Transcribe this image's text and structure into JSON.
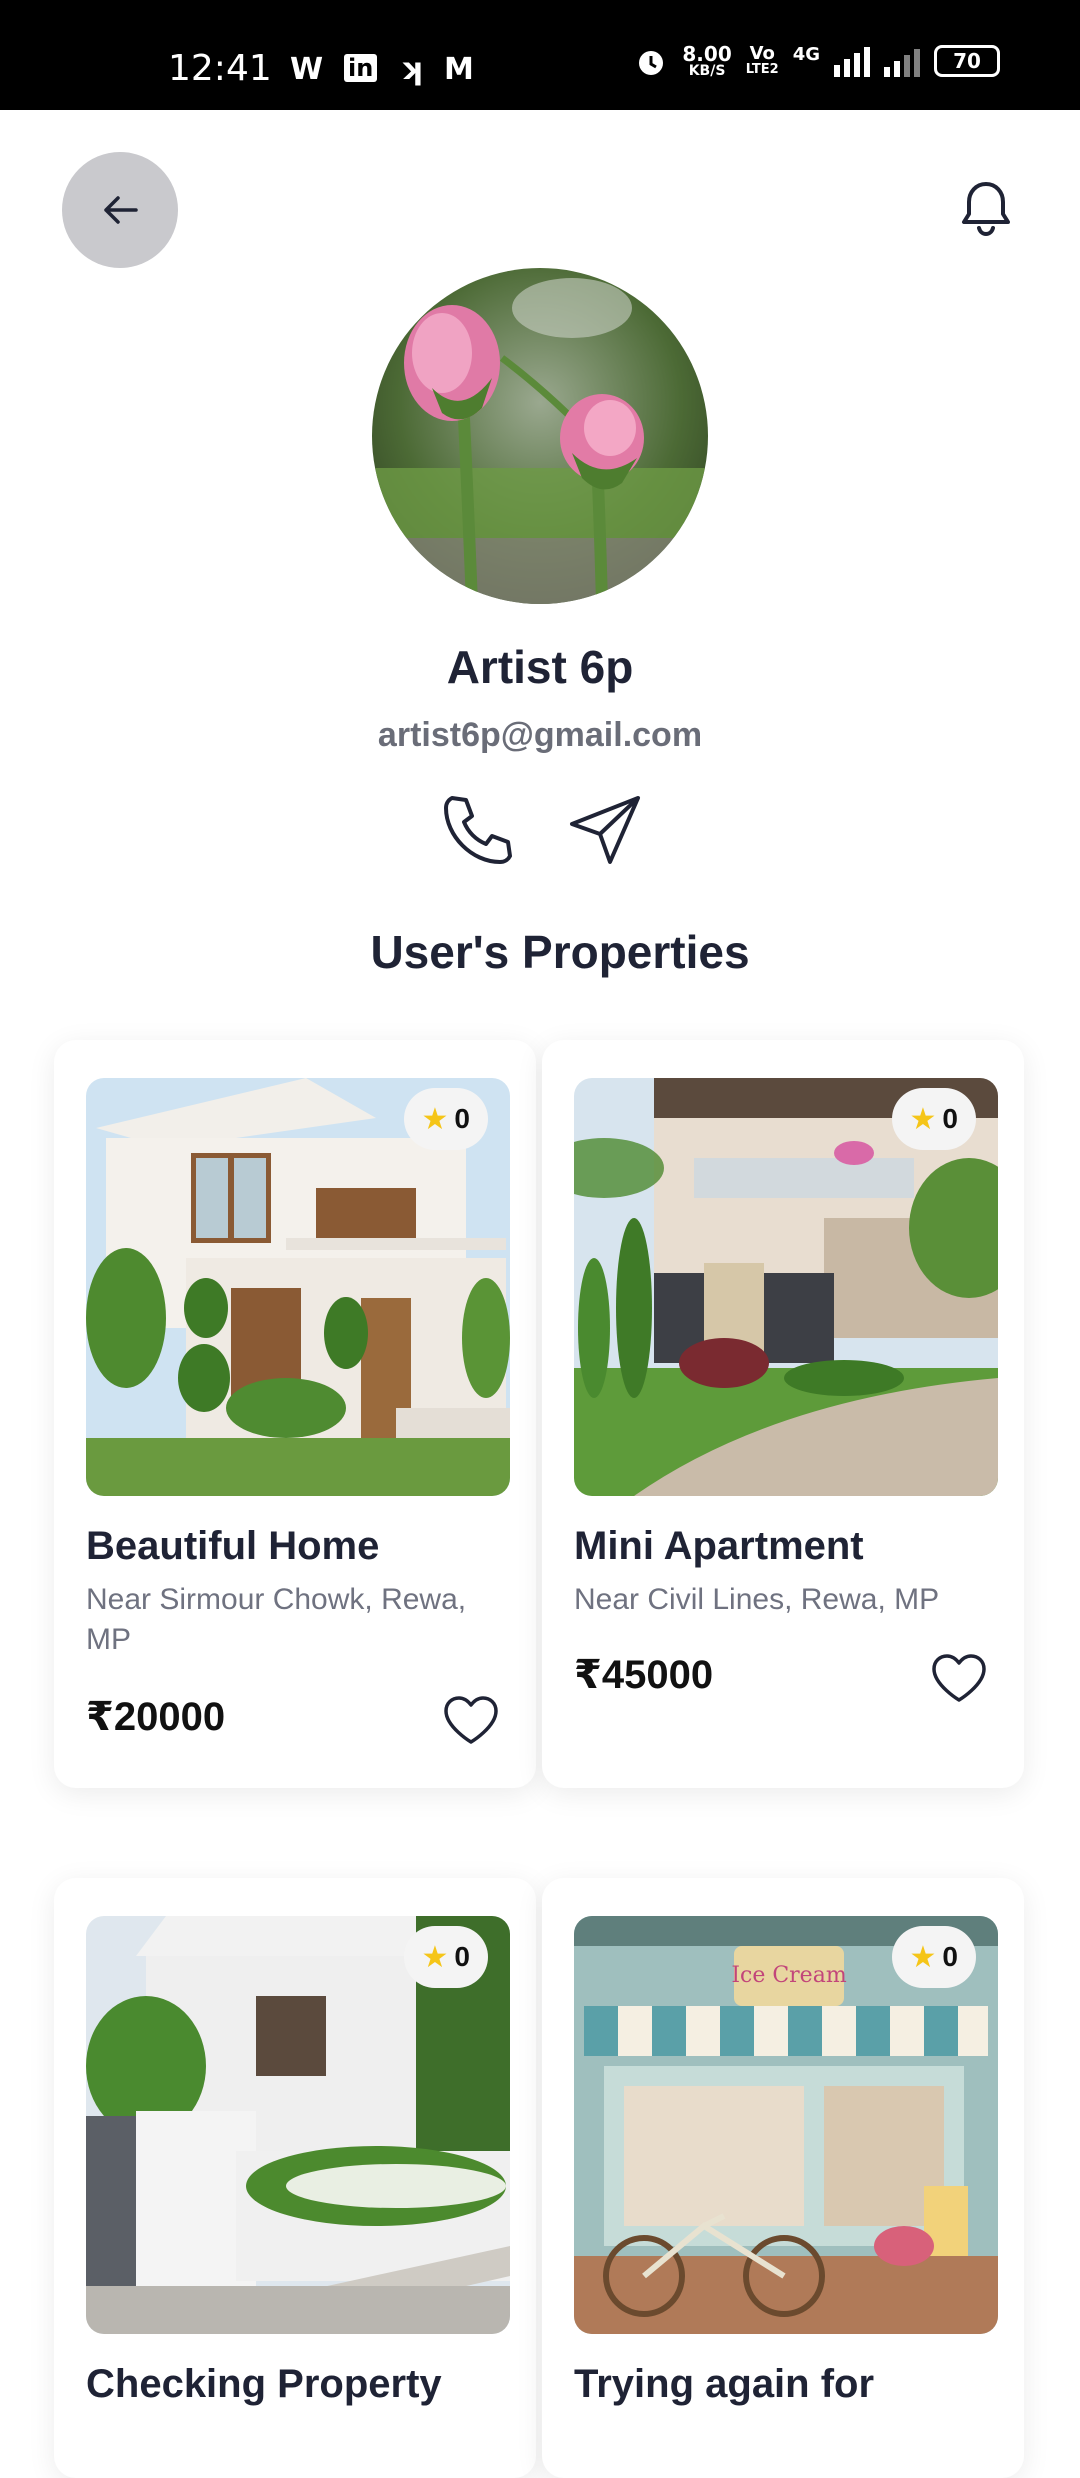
{
  "status_bar": {
    "time": "12:41",
    "speed_value": "8.00",
    "speed_unit": "KB/S",
    "network": "4G",
    "battery": "70",
    "volte": "Vo",
    "lte": "LTE2"
  },
  "header": {
    "back_icon": "arrow-left-icon",
    "notification_icon": "bell-icon"
  },
  "profile": {
    "name": "Artist 6p",
    "email": "artist6p@gmail.com",
    "actions": [
      "phone-icon",
      "send-icon"
    ]
  },
  "section_title": "User's Properties",
  "properties": [
    {
      "title": "Beautiful Home",
      "location": "Near Sirmour Chowk, Rewa, MP",
      "price": "₹20000",
      "rating": "0"
    },
    {
      "title": "Mini Apartment",
      "location": "Near Civil Lines, Rewa, MP",
      "price": "₹45000",
      "rating": "0"
    },
    {
      "title": "Checking Property",
      "location": "",
      "price": "",
      "rating": "0"
    },
    {
      "title": "Trying again for",
      "location": "",
      "price": "",
      "rating": "0"
    }
  ],
  "colors": {
    "accent_star": "#f5c518",
    "text_dark": "#1f2335",
    "back_button_bg": "#c9c9cd"
  }
}
